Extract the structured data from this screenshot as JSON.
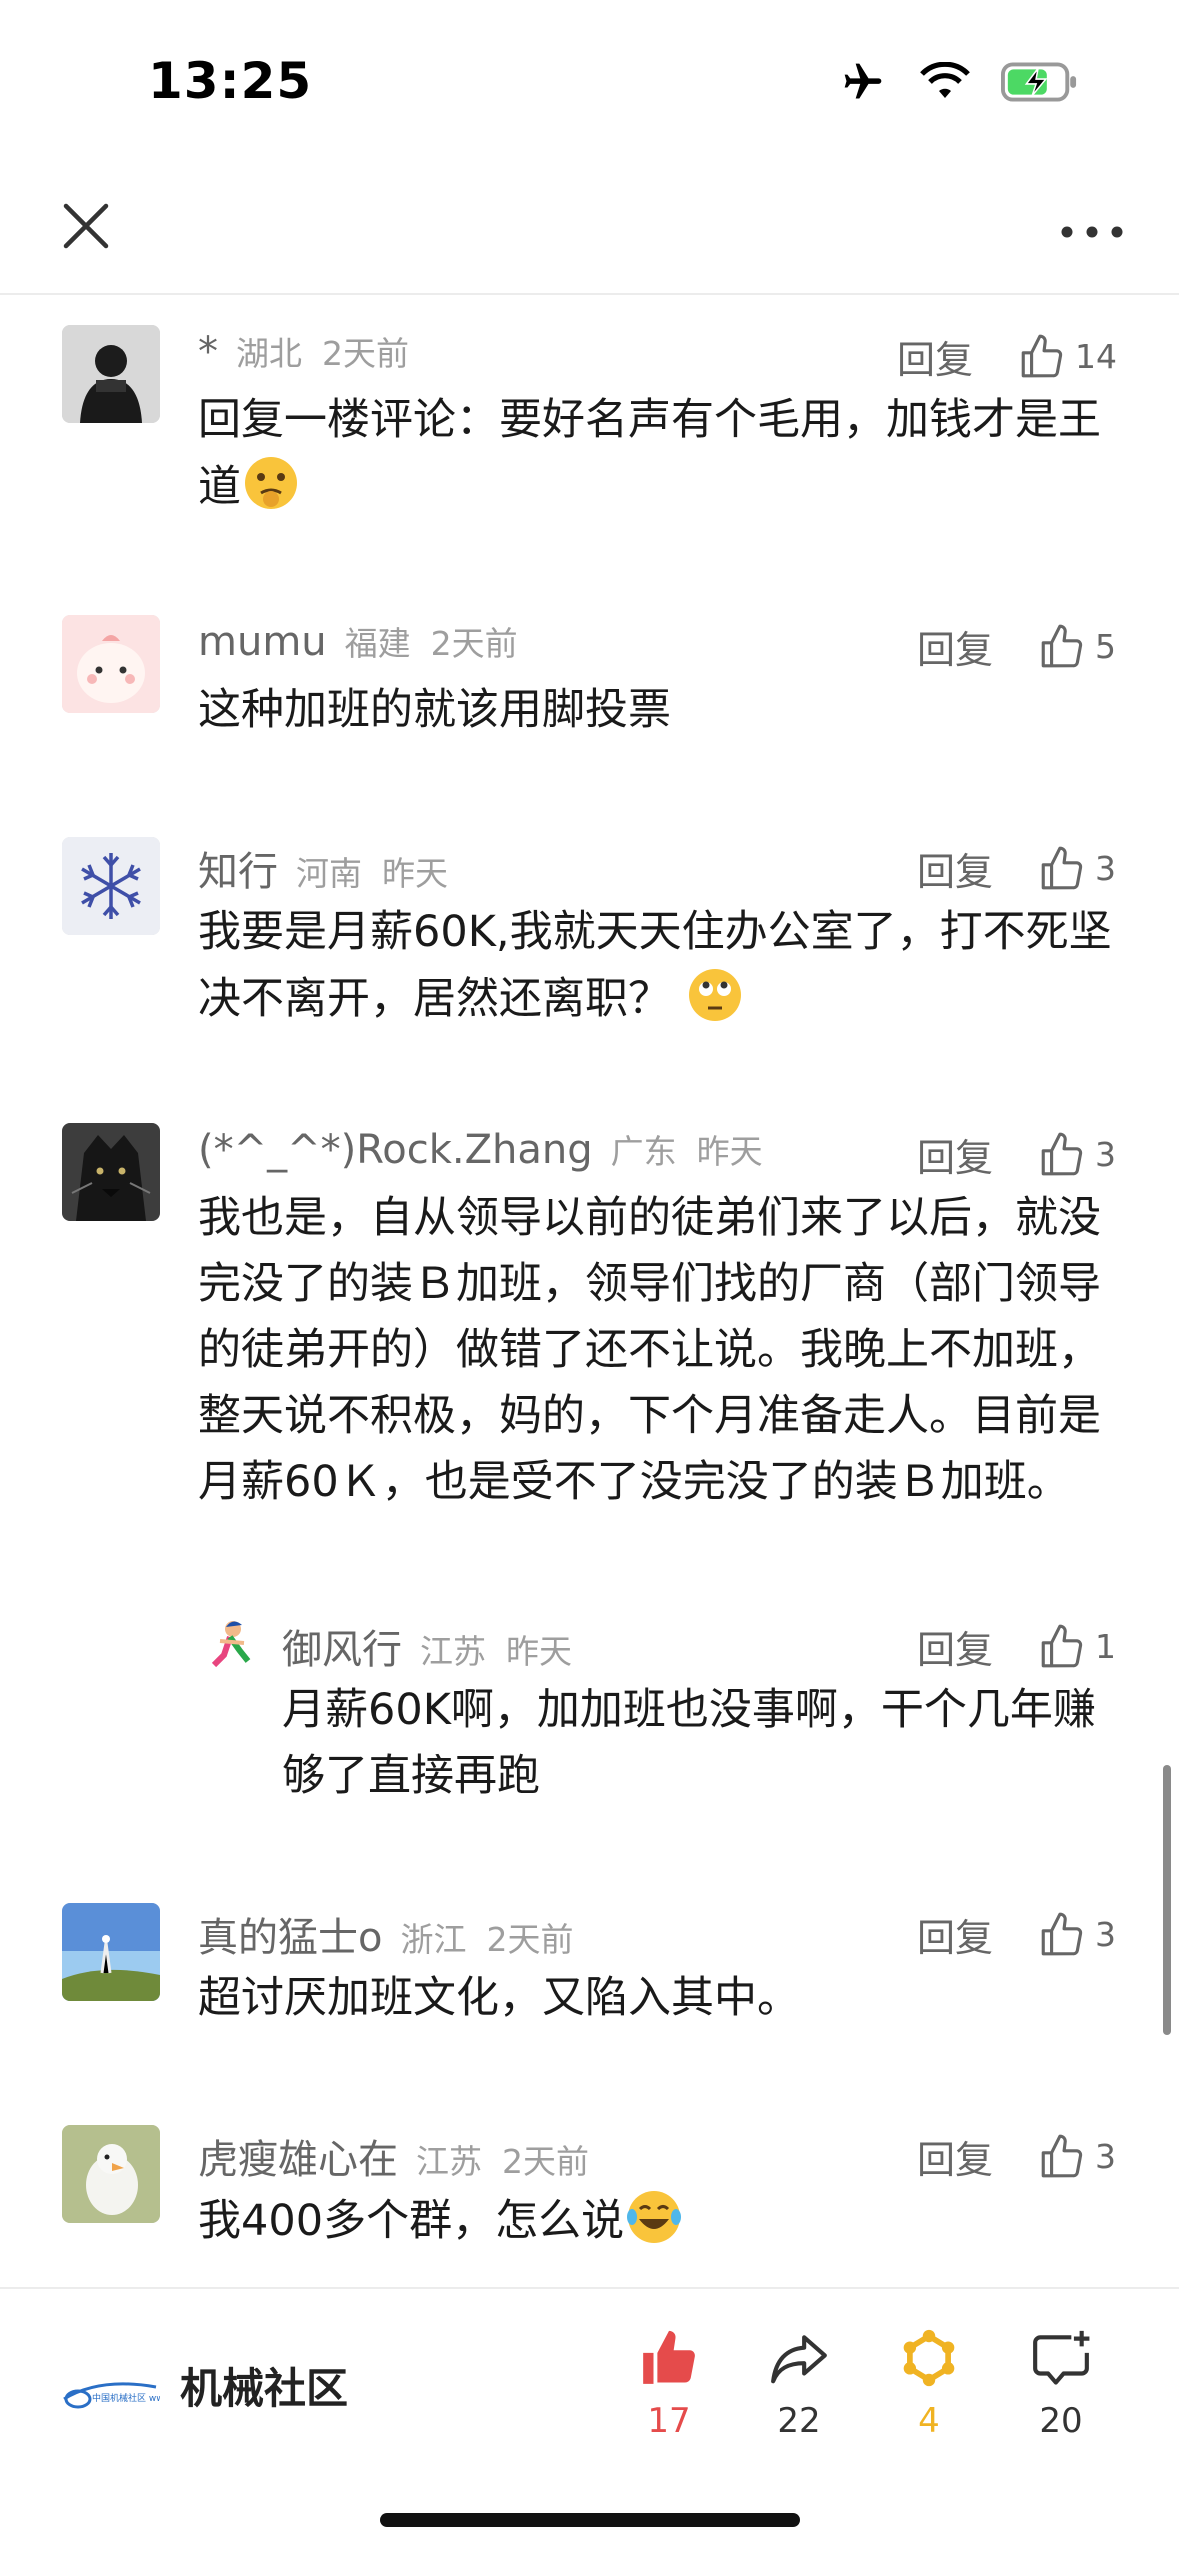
{
  "status": {
    "time": "13:25"
  },
  "nav": {
    "close_icon": "close-icon",
    "more_icon": "more-dots-icon"
  },
  "comments": [
    {
      "name": "*",
      "region": "湖北",
      "time": "2天前",
      "reply": "回复",
      "likes": "14",
      "text": "回复一楼评论：要好名声有个毛用，加钱才是王道"
    },
    {
      "name": "mumu",
      "region": "福建",
      "time": "2天前",
      "reply": "回复",
      "likes": "5",
      "text": "这种加班的就该用脚投票"
    },
    {
      "name": "知行",
      "region": "河南",
      "time": "昨天",
      "reply": "回复",
      "likes": "3",
      "text": "我要是月薪60K,我就天天住办公室了，打不死坚决不离开，居然还离职？"
    },
    {
      "name": "(*^_^*)Rock.Zhang",
      "region": "广东",
      "time": "昨天",
      "reply": "回复",
      "likes": "3",
      "text": "我也是，自从领导以前的徒弟们来了以后，就没完没了的装Ｂ加班，领导们找的厂商（部门领导的徒弟开的）做错了还不让说。我晚上不加班，整天说不积极，妈的，下个月准备走人。目前是月薪60Ｋ，也是受不了没完没了的装Ｂ加班。"
    },
    {
      "name": "真的猛士o",
      "region": "浙江",
      "time": "2天前",
      "reply": "回复",
      "likes": "3",
      "text": "超讨厌加班文化，又陷入其中。"
    },
    {
      "name": "虎瘦雄心在",
      "region": "江苏",
      "time": "2天前",
      "reply": "回复",
      "likes": "3",
      "text": "我400多个群，怎么说"
    }
  ],
  "nested_reply": {
    "name": "御风行",
    "region": "江苏",
    "time": "昨天",
    "reply": "回复",
    "likes": "1",
    "text": "月薪60K啊，加加班也没事啊，干个几年赚够了直接再跑"
  },
  "bottom": {
    "brand_name": "机械社区",
    "logo_text": "中国机械社区 www.cmiw.cn",
    "like_count": "17",
    "share_count": "22",
    "collect_count": "4",
    "comment_count": "20",
    "colors": {
      "like": "#e54b4b",
      "collect": "#f0b323",
      "text": "#333333"
    }
  }
}
